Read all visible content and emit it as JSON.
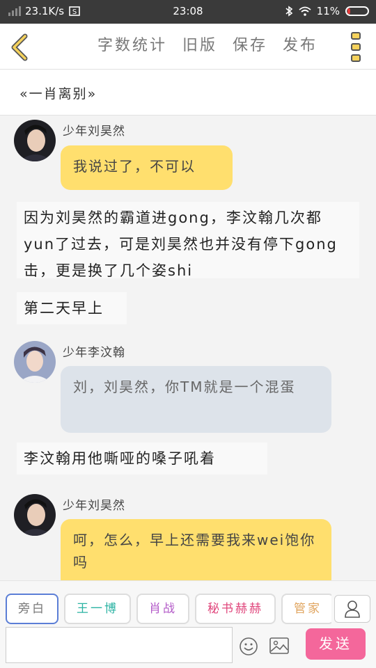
{
  "status_bar": {
    "net_speed": "23.1K/s",
    "time": "23:08",
    "battery": "11%"
  },
  "header": {
    "actions": [
      "字数统计",
      "旧版",
      "保存",
      "发布"
    ]
  },
  "title": "«一肖离别»",
  "messages": [
    {
      "type": "dialogue",
      "speaker": "少年刘昊然",
      "text": "我说过了，不可以",
      "bubble_color": "#ffdf6e"
    },
    {
      "type": "narration",
      "text": "因为刘昊然的霸道进gong，李汶翰几次都yun了过去，可是刘昊然也并没有停下gong击，更是换了几个姿shi"
    },
    {
      "type": "narration",
      "text": "第二天早上"
    },
    {
      "type": "dialogue",
      "speaker": "少年李汶翰",
      "text": "刘，刘昊然，你TM就是一个混蛋",
      "bubble_color": "#dde3ea"
    },
    {
      "type": "narration",
      "text": "李汶翰用他嘶哑的嗓子吼着"
    },
    {
      "type": "dialogue",
      "speaker": "少年刘昊然",
      "text": "呵，怎么，早上还需要我来wei饱你吗",
      "bubble_color": "#ffdf6e"
    }
  ],
  "roles": [
    {
      "label": "旁白",
      "color": "#777777",
      "border": "#5b7ed6"
    },
    {
      "label": "王一博",
      "color": "#2bb3a3",
      "border": "#dddddd"
    },
    {
      "label": "肖战",
      "color": "#b35ac8",
      "border": "#dddddd"
    },
    {
      "label": "秘书赫赫",
      "color": "#e0457b",
      "border": "#dddddd"
    },
    {
      "label": "管家",
      "color": "#e0a45e",
      "border": "#dddddd"
    }
  ],
  "input": {
    "value": "",
    "placeholder": ""
  },
  "send_label": "发送",
  "icons": {
    "back": "chevron-left-icon",
    "menu": "more-icon",
    "person": "person-icon",
    "emoji": "emoji-icon",
    "image": "image-icon"
  },
  "colors": {
    "accent": "#f5d25c",
    "send": "#f4679b",
    "bubble_yellow": "#ffdf6e",
    "bubble_blue": "#dde3ea"
  }
}
